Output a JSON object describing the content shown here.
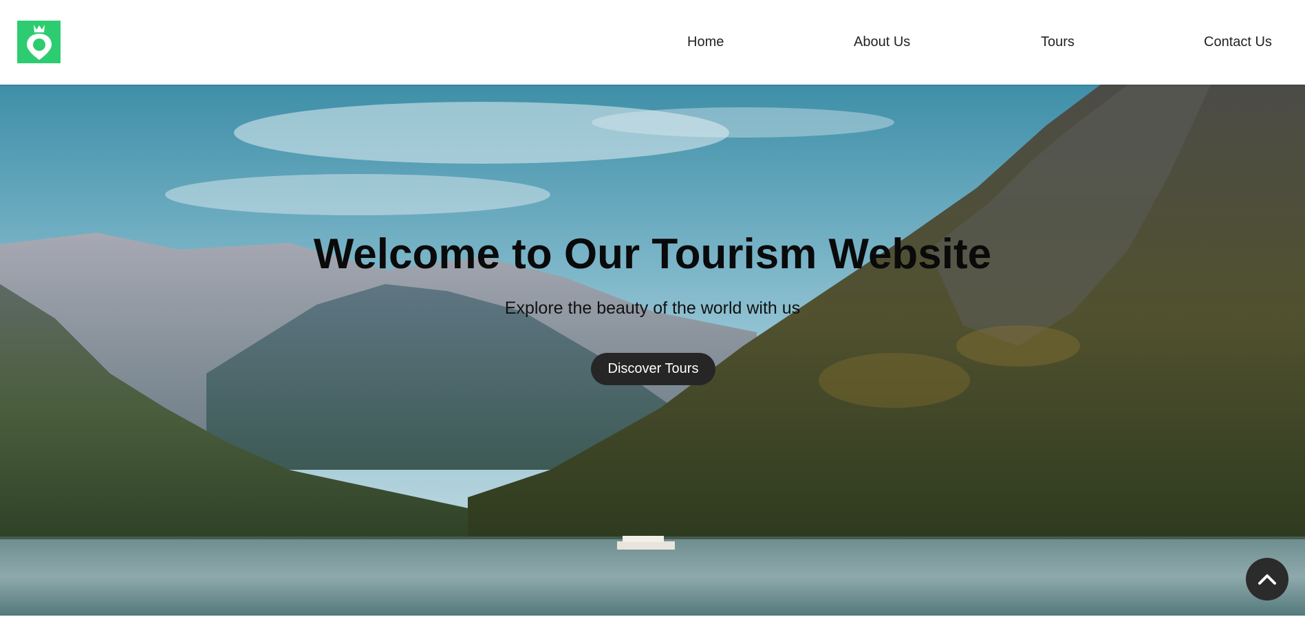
{
  "nav": {
    "logo_icon": "map-pin-crown-icon",
    "items": [
      {
        "label": "Home"
      },
      {
        "label": "About Us"
      },
      {
        "label": "Tours"
      },
      {
        "label": "Contact Us"
      }
    ]
  },
  "hero": {
    "title": "Welcome to Our Tourism Website",
    "subtitle": "Explore the beauty of the world with us",
    "cta_label": "Discover Tours",
    "background": "mountain-lake-photo"
  },
  "back_to_top_icon": "chevron-up-icon",
  "colors": {
    "brand_green": "#2ecc71",
    "button_dark": "#262626",
    "nav_text": "#222222"
  }
}
